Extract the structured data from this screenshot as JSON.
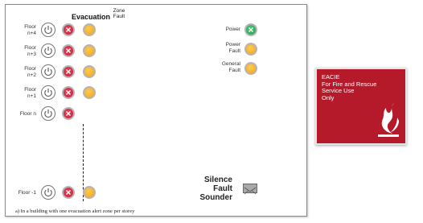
{
  "panel": {
    "header_evacuation": "Evacuation",
    "header_zone_fault": [
      "Zone",
      "Fault"
    ],
    "floors": [
      {
        "label": [
          "Floor",
          "n+4"
        ]
      },
      {
        "label": [
          "Floor",
          "n+3"
        ]
      },
      {
        "label": [
          "Floor",
          "n+2"
        ]
      },
      {
        "label": [
          "Floor",
          "n+1"
        ]
      },
      {
        "label": [
          "Floor n"
        ]
      },
      {
        "label": [
          "Floor -1"
        ]
      }
    ],
    "status": [
      {
        "label": [
          "Power"
        ],
        "color": "#2eb35a"
      },
      {
        "label": [
          "Power",
          "Fault"
        ],
        "color": "#f5b530"
      },
      {
        "label": [
          "General",
          "Fault"
        ],
        "color": "#f5b530"
      }
    ],
    "silence": [
      "Silence",
      "Fault",
      "Sounder"
    ],
    "caption": "a) In a building with one evacuation alert zone per storey"
  },
  "eacie_sign": {
    "lines": [
      "EACIE",
      "For Fire and Rescue",
      "Service Use",
      "Only"
    ],
    "background": "#b51a2b",
    "icon": "flame-icon"
  },
  "colors": {
    "evacuation_led": "#d92b45",
    "zone_fault_led": "#f5b530",
    "power_led": "#2eb35a"
  }
}
